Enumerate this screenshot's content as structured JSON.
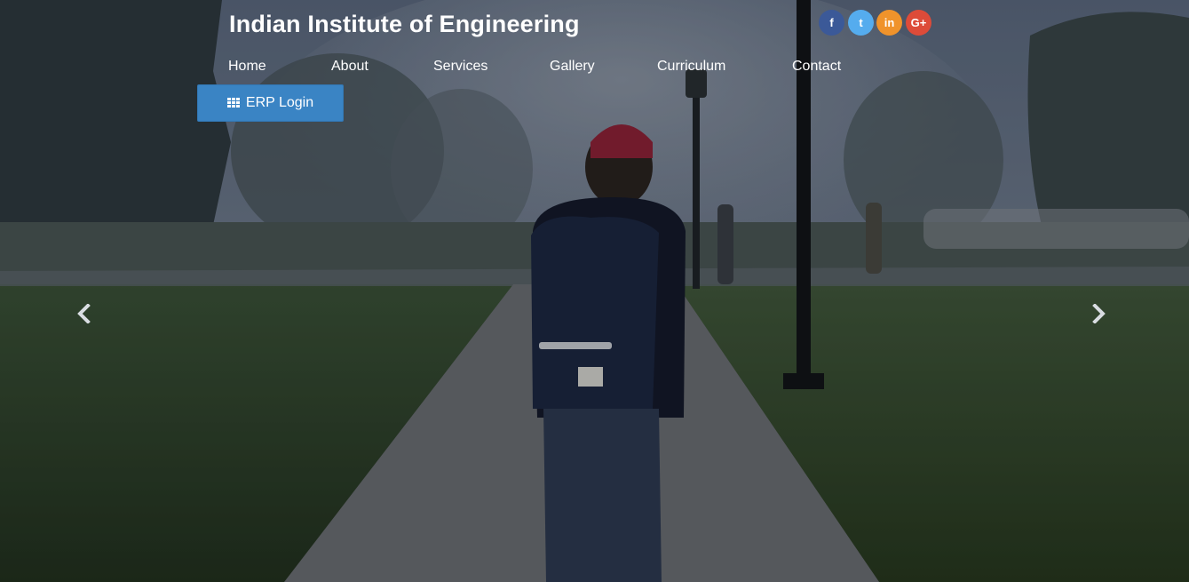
{
  "brand": {
    "title": "Indian Institute of Engineering"
  },
  "nav": {
    "items": [
      {
        "label": "Home"
      },
      {
        "label": "About"
      },
      {
        "label": "Services"
      },
      {
        "label": "Gallery"
      },
      {
        "label": "Curriculum"
      },
      {
        "label": "Contact"
      }
    ]
  },
  "erp": {
    "label": "ERP Login",
    "icon": "grid-icon",
    "color": "#3a84c4"
  },
  "social": [
    {
      "name": "facebook-icon",
      "glyph": "f",
      "color": "#3b5998"
    },
    {
      "name": "twitter-icon",
      "glyph": "t",
      "color": "#55acee"
    },
    {
      "name": "linkedin-icon",
      "glyph": "in",
      "color": "#f0932b"
    },
    {
      "name": "google-plus-icon",
      "glyph": "G+",
      "color": "#dd4b39"
    }
  ],
  "carousel": {
    "prev_icon": "chevron-left-icon",
    "next_icon": "chevron-right-icon"
  }
}
